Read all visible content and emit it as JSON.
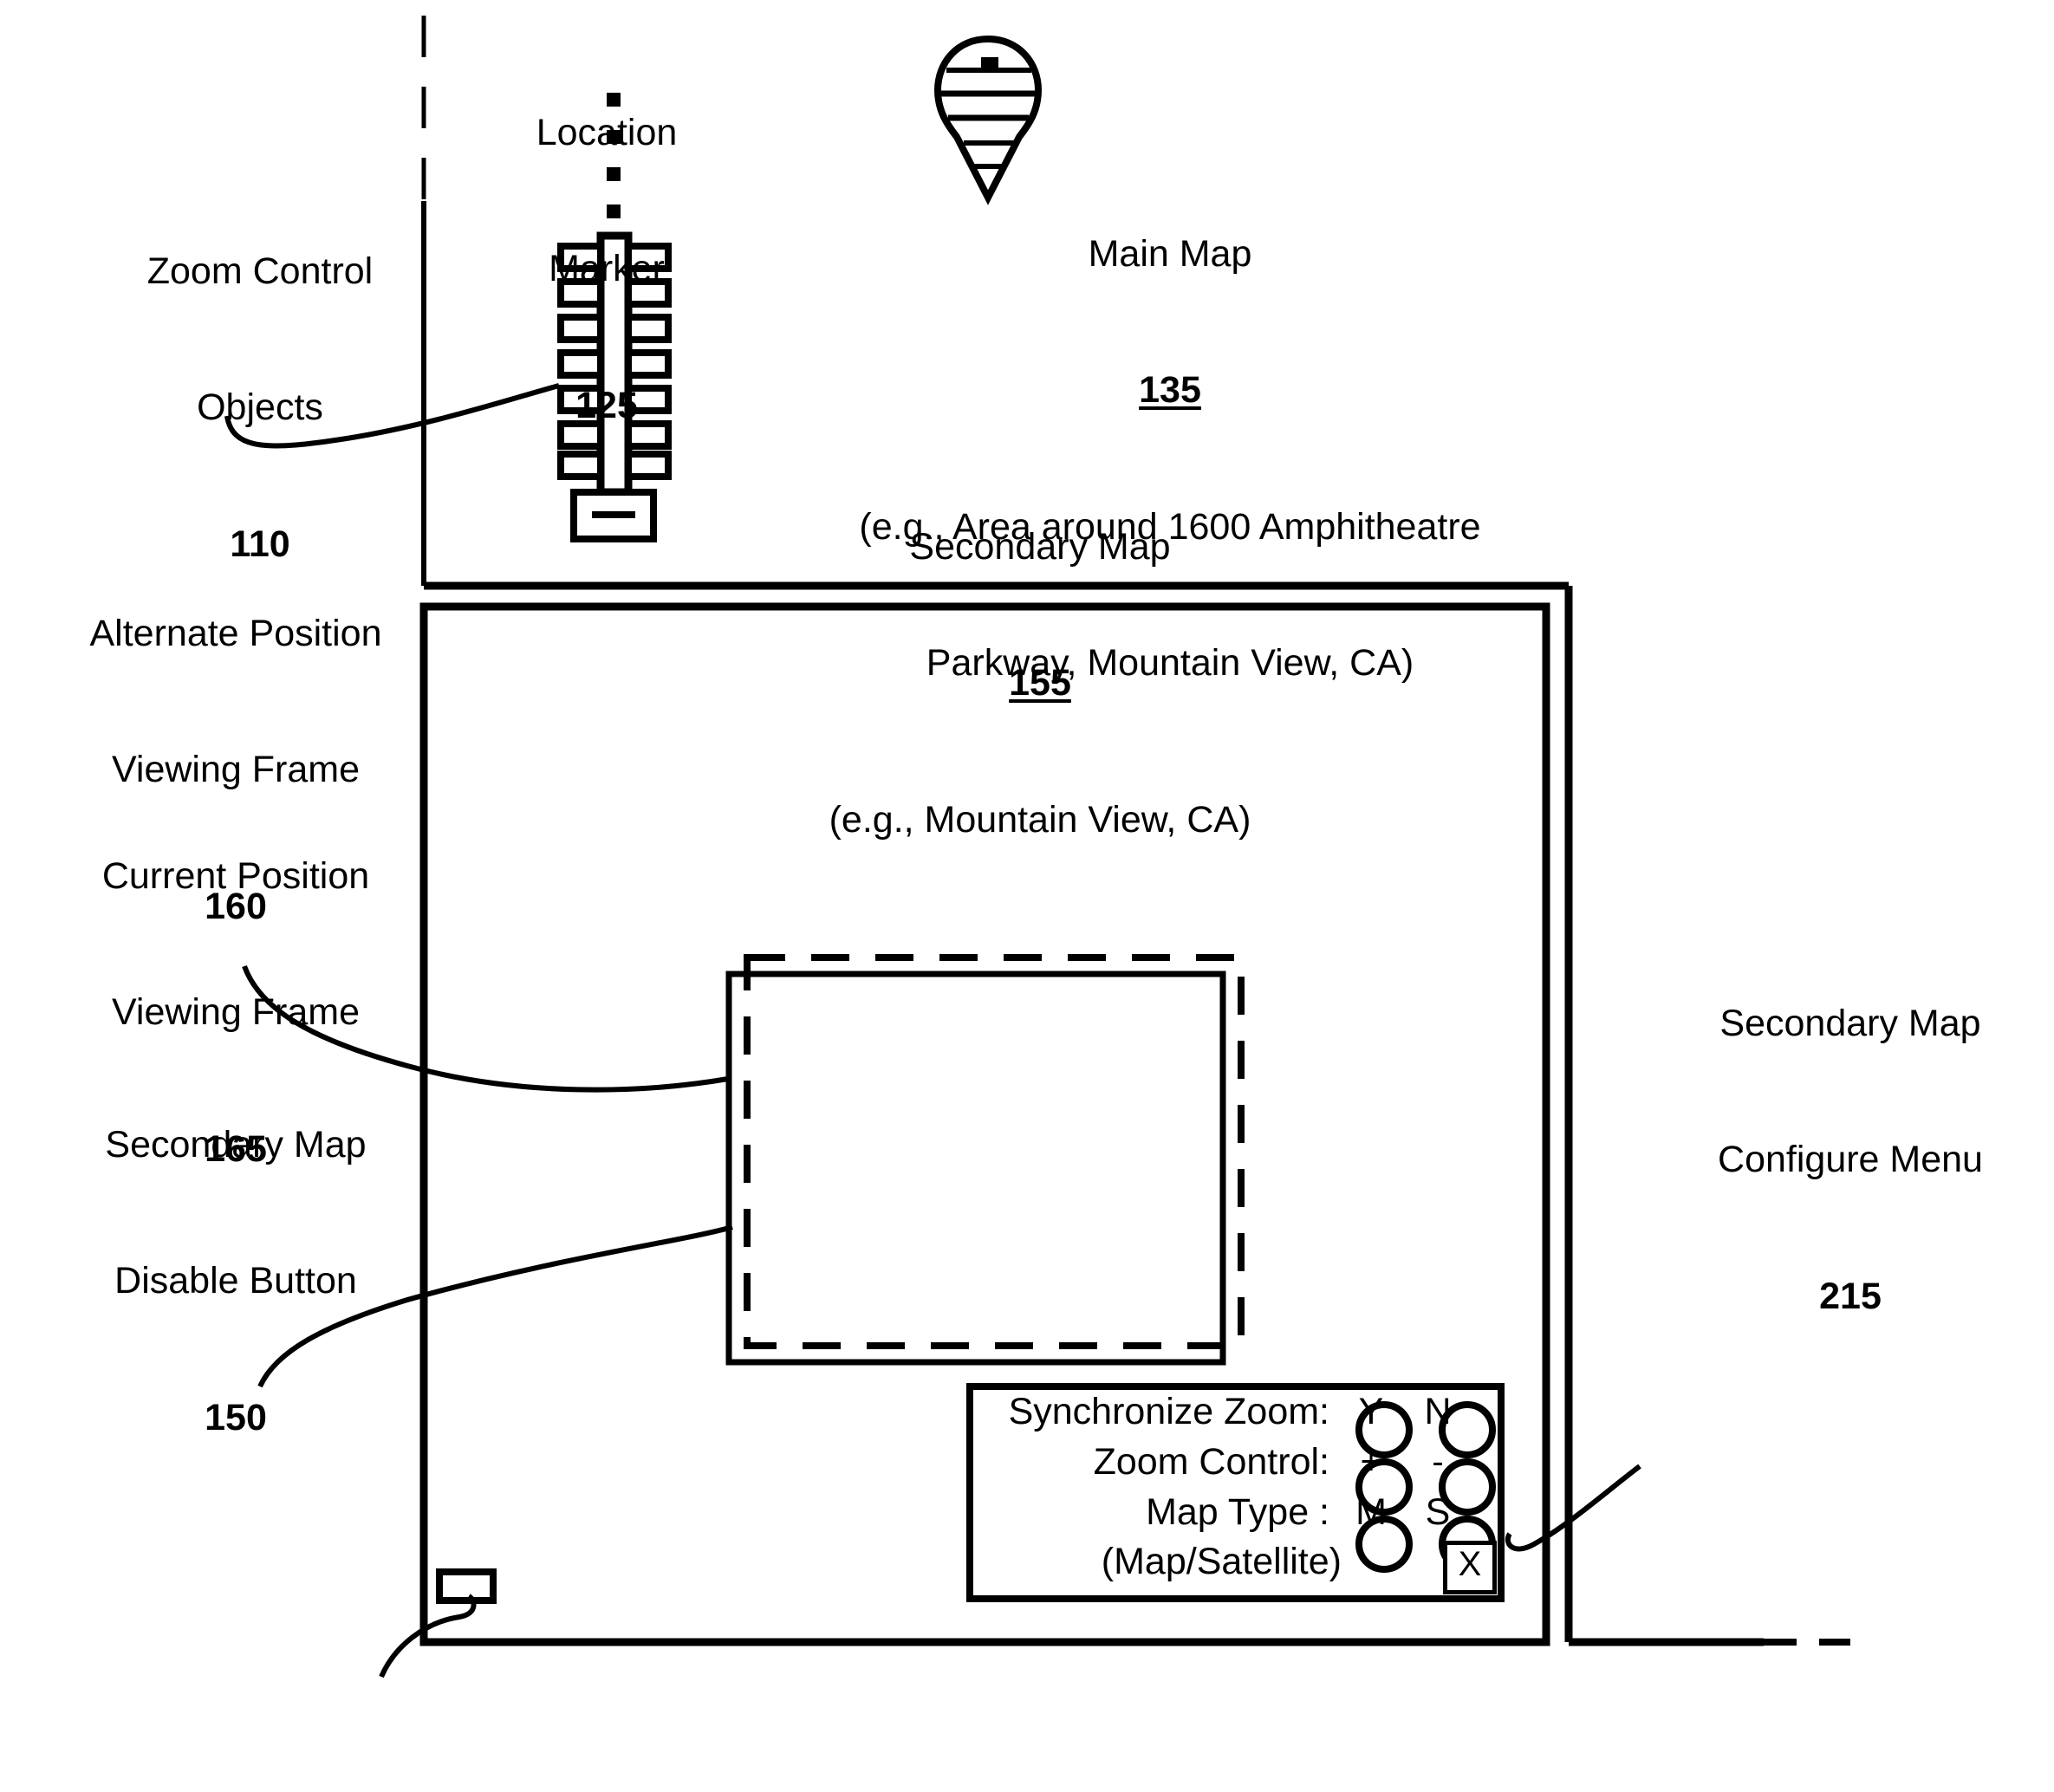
{
  "figure": {
    "type": "patent-diagram",
    "background": "#ffffff",
    "ink_color": "#000000"
  },
  "labels": {
    "zoom_control_objects": {
      "line1": "Zoom Control",
      "line2": "Objects",
      "ref": "110"
    },
    "location_marker": {
      "line1": "Location",
      "line2": "Marker",
      "ref": "125"
    },
    "main_map": {
      "line1": "Main Map",
      "ref": "135",
      "line3": "(e.g., Area around 1600 Amphitheatre",
      "line4": "Parkway, Mountain View, CA)"
    },
    "secondary_map": {
      "line1": "Secondary Map",
      "ref": "155",
      "line3": "(e.g., Mountain View, CA)"
    },
    "alternate_position_viewing_frame": {
      "line1": "Alternate Position",
      "line2": "Viewing Frame",
      "ref": "160"
    },
    "current_position_viewing_frame": {
      "line1": "Current Position",
      "line2": "Viewing Frame",
      "ref": "165"
    },
    "secondary_map_disable_button": {
      "line1": "Secondary Map",
      "line2": "Disable Button",
      "ref": "150"
    },
    "secondary_map_configure_menu": {
      "line1": "Secondary Map",
      "line2": "Configure Menu",
      "ref": "215"
    }
  },
  "configure_menu": {
    "rows": [
      {
        "label": "Synchronize Zoom:",
        "option_a": "Y",
        "option_b": "N"
      },
      {
        "label": "Zoom Control:",
        "option_a": "+",
        "option_b": "-"
      },
      {
        "label": "Map Type :",
        "option_a": "M",
        "option_b": "S"
      }
    ],
    "map_type_sublabel": "(Map/Satellite)",
    "close_label": "X"
  },
  "zoom_control": {
    "tick_count": 7,
    "zoom_out_label": "—",
    "ellipsis_dots": 4
  },
  "colors": {
    "ink": "#000000",
    "paper": "#ffffff"
  }
}
